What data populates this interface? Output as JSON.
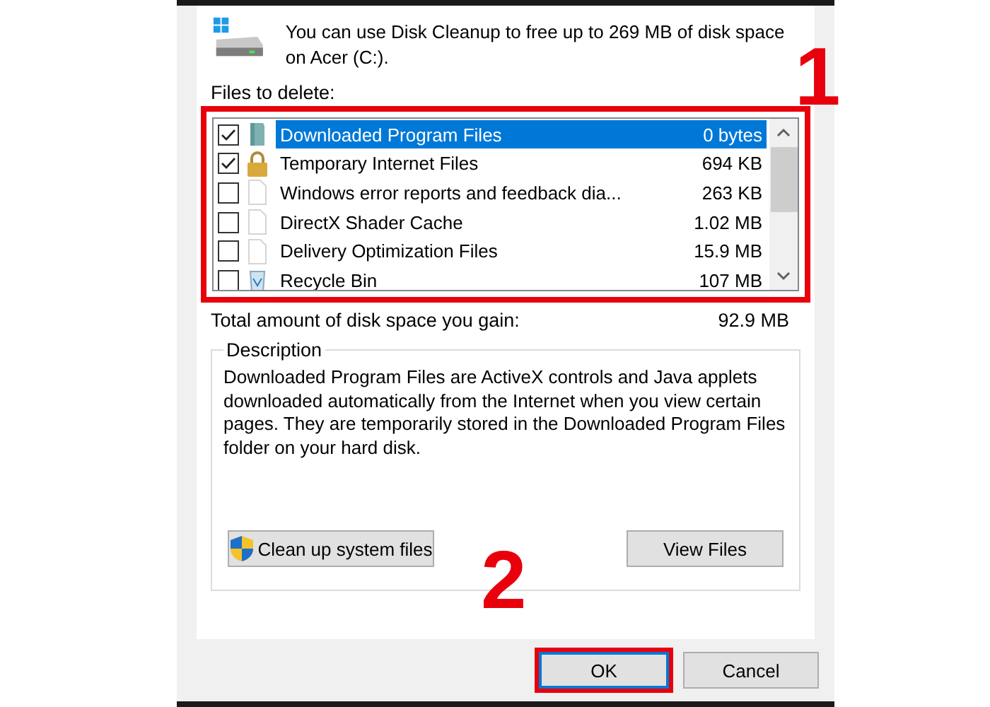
{
  "header": {
    "message": "You can use Disk Cleanup to free up to 269 MB of disk space on Acer (C:)."
  },
  "files_label": "Files to delete:",
  "files": {
    "highlighted": true,
    "items": [
      {
        "kind": "folder",
        "name": "Downloaded Program Files",
        "size": "0 bytes",
        "checked": true,
        "selected": true
      },
      {
        "kind": "lock",
        "name": "Temporary Internet Files",
        "size": "694 KB",
        "checked": true,
        "selected": false
      },
      {
        "kind": "page",
        "name": "Windows error reports and feedback dia...",
        "size": "263 KB",
        "checked": false,
        "selected": false
      },
      {
        "kind": "page",
        "name": "DirectX Shader Cache",
        "size": "1.02 MB",
        "checked": false,
        "selected": false
      },
      {
        "kind": "page",
        "name": "Delivery Optimization Files",
        "size": "15.9 MB",
        "checked": false,
        "selected": false
      },
      {
        "kind": "recycle",
        "name": "Recycle Bin",
        "size": "107 MB",
        "checked": false,
        "selected": false
      }
    ]
  },
  "total": {
    "label": "Total amount of disk space you gain:",
    "value": "92.9 MB"
  },
  "description": {
    "title": "Description",
    "text": "Downloaded Program Files are ActiveX controls and Java applets downloaded automatically from the Internet when you view certain pages. They are temporarily stored in the Downloaded Program Files folder on your hard disk.",
    "buttons": [
      {
        "kind": "shield",
        "label": "Clean up system files"
      },
      {
        "kind": "plain",
        "label": "View Files"
      }
    ]
  },
  "footer_buttons": [
    {
      "label": "OK",
      "default": true,
      "highlighted": true
    },
    {
      "label": "Cancel",
      "default": false,
      "highlighted": false
    }
  ],
  "annotations": [
    {
      "label": "1"
    },
    {
      "label": "2"
    }
  ]
}
